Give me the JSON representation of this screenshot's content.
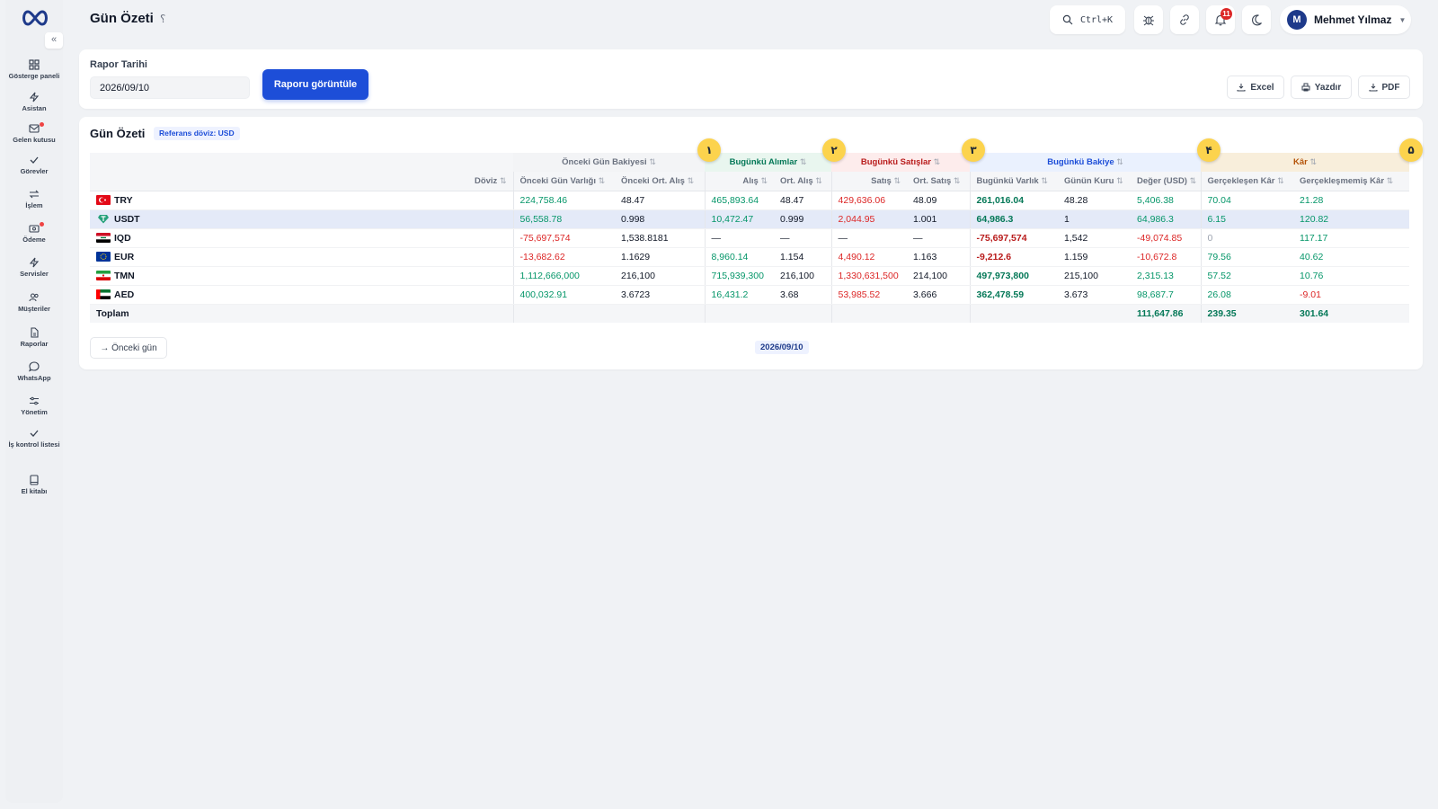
{
  "sidebar": {
    "collapse_label": "«",
    "items": [
      {
        "label": "Gösterge paneli",
        "icon": "dashboard-icon"
      },
      {
        "label": "Asistan",
        "icon": "bolt-icon"
      },
      {
        "label": "Gelen kutusu",
        "icon": "inbox-icon"
      },
      {
        "label": "Görevler",
        "icon": "check-icon"
      },
      {
        "label": "İşlem",
        "icon": "transfer-icon"
      },
      {
        "label": "Ödeme",
        "icon": "payment-icon"
      },
      {
        "label": "Servisler",
        "icon": "bolt-icon"
      },
      {
        "label": "Müşteriler",
        "icon": "users-icon"
      },
      {
        "label": "Raporlar",
        "icon": "report-icon"
      },
      {
        "label": "WhatsApp",
        "icon": "chat-icon"
      },
      {
        "label": "Yönetim",
        "icon": "sliders-icon"
      },
      {
        "label": "İş kontrol listesi",
        "icon": "check-icon"
      },
      {
        "label": "El kitabı",
        "icon": "book-icon"
      }
    ]
  },
  "header": {
    "title": "Gün Özeti",
    "help": "؟",
    "search_shortcut": "Ctrl+K",
    "notification_count": "11",
    "user": {
      "initial": "M",
      "name": "Mehmet Yılmaz"
    }
  },
  "filter": {
    "date_label": "Rapor Tarihi",
    "date_value": "2026/09/10",
    "view_button": "Raporu görüntüle",
    "export": {
      "excel": "Excel",
      "print": "Yazdır",
      "pdf": "PDF"
    }
  },
  "report": {
    "title": "Gün Özeti",
    "reference_badge": "Referans döviz: USD",
    "groups": {
      "previous": "Önceki Gün Bakiyesi",
      "buys": "Bugünkü Alımlar",
      "sales": "Bugünkü Satışlar",
      "balance": "Bugünkü Bakiye",
      "profit": "Kâr"
    },
    "sort_glyph": "⇅",
    "columns": {
      "currency": "Döviz",
      "prev_asset": "Önceki Gün Varlığı",
      "prev_avg_buy": "Önceki Ort. Alış",
      "buy": "Alış",
      "avg_buy": "Ort. Alış",
      "sell": "Satış",
      "avg_sell": "Ort. Satış",
      "today_asset": "Bugünkü Varlık",
      "day_rate": "Günün Kuru",
      "value_usd": "Değer (USD)",
      "realized": "Gerçekleşen Kâr",
      "unrealized": "Gerçekleşmemiş Kâr"
    },
    "rows": [
      {
        "code": "TRY",
        "prev_asset": "224,758.46",
        "prev_avg_buy": "48.47",
        "buy": "465,893.64",
        "avg_buy": "48.47",
        "sell": "429,636.06",
        "avg_sell": "48.09",
        "today_asset": "261,016.04",
        "day_rate": "48.28",
        "value_usd": "5,406.38",
        "realized": "70.04",
        "unrealized": "21.28"
      },
      {
        "code": "USDT",
        "prev_asset": "56,558.78",
        "prev_avg_buy": "0.998",
        "buy": "10,472.47",
        "avg_buy": "0.999",
        "sell": "2,044.95",
        "avg_sell": "1.001",
        "today_asset": "64,986.3",
        "day_rate": "1",
        "value_usd": "64,986.3",
        "realized": "6.15",
        "unrealized": "120.82"
      },
      {
        "code": "IQD",
        "prev_asset": "-75,697,574",
        "prev_avg_buy": "1,538.8181",
        "buy": "—",
        "avg_buy": "—",
        "sell": "—",
        "avg_sell": "—",
        "today_asset": "-75,697,574",
        "day_rate": "1,542",
        "value_usd": "-49,074.85",
        "realized": "0",
        "unrealized": "117.17"
      },
      {
        "code": "EUR",
        "prev_asset": "-13,682.62",
        "prev_avg_buy": "1.1629",
        "buy": "8,960.14",
        "avg_buy": "1.154",
        "sell": "4,490.12",
        "avg_sell": "1.163",
        "today_asset": "-9,212.6",
        "day_rate": "1.159",
        "value_usd": "-10,672.8",
        "realized": "79.56",
        "unrealized": "40.62"
      },
      {
        "code": "TMN",
        "prev_asset": "1,112,666,000",
        "prev_avg_buy": "216,100",
        "buy": "715,939,300",
        "avg_buy": "216,100",
        "sell": "1,330,631,500",
        "avg_sell": "214,100",
        "today_asset": "497,973,800",
        "day_rate": "215,100",
        "value_usd": "2,315.13",
        "realized": "57.52",
        "unrealized": "10.76"
      },
      {
        "code": "AED",
        "prev_asset": "400,032.91",
        "prev_avg_buy": "3.6723",
        "buy": "16,431.2",
        "avg_buy": "3.68",
        "sell": "53,985.52",
        "avg_sell": "3.666",
        "today_asset": "362,478.59",
        "day_rate": "3.673",
        "value_usd": "98,687.7",
        "realized": "26.08",
        "unrealized": "-9.01"
      }
    ],
    "total": {
      "label": "Toplam",
      "value_usd": "111,647.86",
      "realized": "239.35",
      "unrealized": "301.64"
    },
    "steps": [
      "١",
      "٢",
      "٣",
      "۴",
      "۵"
    ],
    "prev_day_button": "→ Önceki gün",
    "current_date": "2026/09/10"
  },
  "colors": {
    "primary": "#1d4ed8",
    "positive": "#059669",
    "negative": "#dc2626",
    "step_badge": "#fcd34d"
  }
}
